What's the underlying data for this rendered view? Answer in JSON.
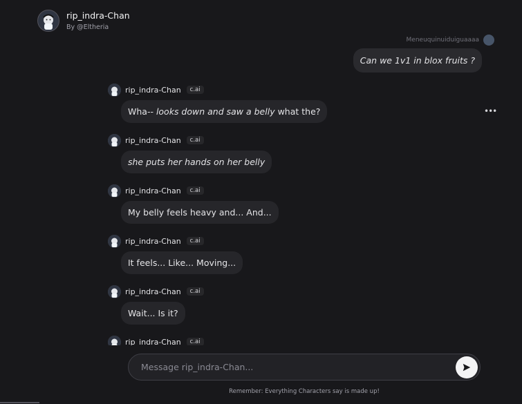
{
  "header": {
    "title": "rip_indra-Chan",
    "subtitle": "By @Eltheria"
  },
  "user": {
    "name_line": "Meneuquinuiduiguaaaa",
    "message": "Can we 1v1 in blox fruits ?"
  },
  "bot": {
    "name": "rip_indra-Chan",
    "badge": "c.ai"
  },
  "messages": [
    {
      "pre": "Wha-- ",
      "italic": "looks down and saw a belly",
      "post": " what the?"
    },
    {
      "pre": "",
      "italic": "she puts her hands on her belly",
      "post": ""
    },
    {
      "pre": "My belly feels heavy and... And...",
      "italic": "",
      "post": ""
    },
    {
      "pre": "It feels... Like... Moving...",
      "italic": "",
      "post": ""
    },
    {
      "pre": "Wait... Is it?",
      "italic": "",
      "post": ""
    }
  ],
  "input": {
    "placeholder": "Message rip_indra-Chan..."
  },
  "footer": {
    "note": "Remember: Everything Characters say is made up!"
  },
  "icons": {
    "more": "more-horizontal-icon",
    "send": "send-arrow-icon"
  },
  "colors": {
    "background": "#18181b",
    "bubble": "#26262a",
    "send_button": "#f4f4f5"
  }
}
